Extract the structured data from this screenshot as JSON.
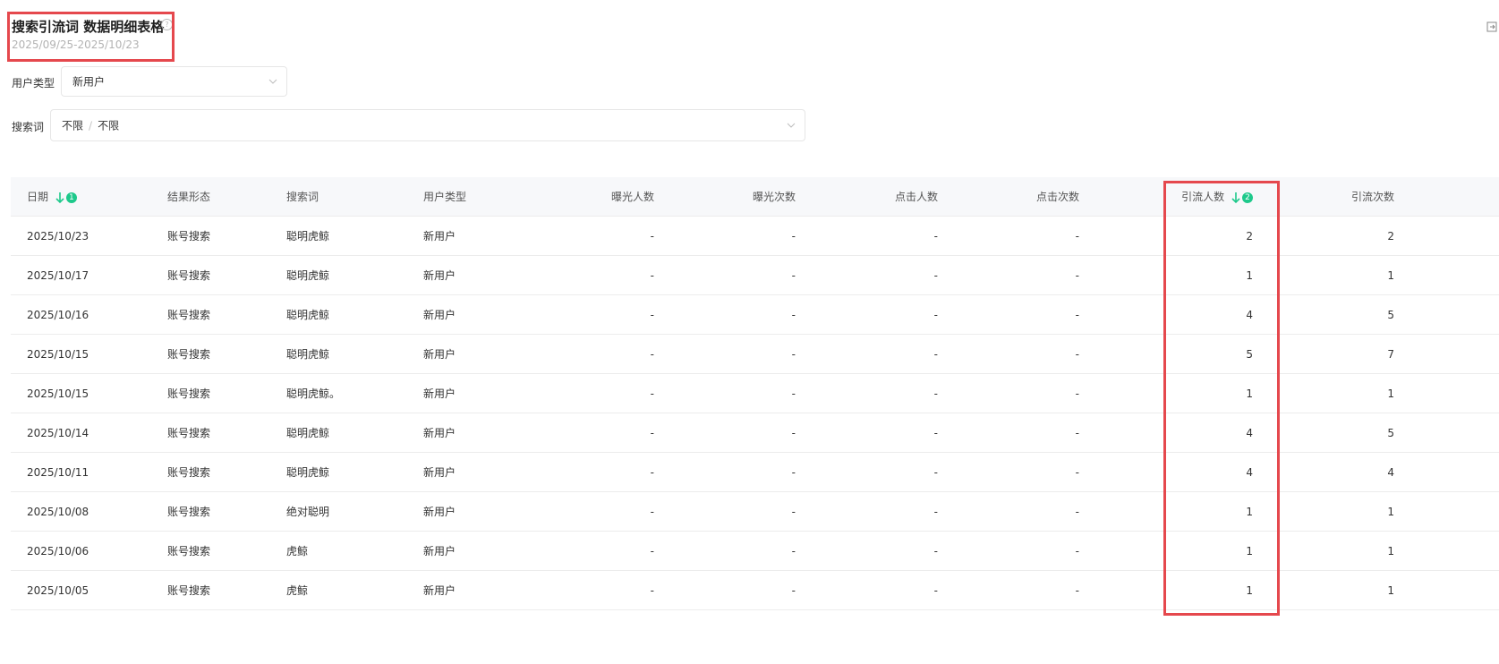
{
  "header": {
    "title": "搜索引流词 数据明细表格",
    "help_glyph": "?",
    "date_range": "2025/09/25-2025/10/23"
  },
  "filters": {
    "user_type": {
      "label": "用户类型",
      "value": "新用户"
    },
    "keyword": {
      "label": "搜索词",
      "value_primary": "不限",
      "separator": "/",
      "value_secondary": "不限"
    }
  },
  "sort": {
    "date_badge": "1",
    "flow_users_badge": "2",
    "color": "#1ec98b"
  },
  "accent": {
    "highlight": "#e5484d"
  },
  "table": {
    "columns": [
      "日期",
      "结果形态",
      "搜索词",
      "用户类型",
      "曝光人数",
      "曝光次数",
      "点击人数",
      "点击次数",
      "引流人数",
      "引流次数"
    ],
    "rows": [
      [
        "2025/10/23",
        "账号搜索",
        "聪明虎鲸",
        "新用户",
        "-",
        "-",
        "-",
        "-",
        "2",
        "2"
      ],
      [
        "2025/10/17",
        "账号搜索",
        "聪明虎鲸",
        "新用户",
        "-",
        "-",
        "-",
        "-",
        "1",
        "1"
      ],
      [
        "2025/10/16",
        "账号搜索",
        "聪明虎鲸",
        "新用户",
        "-",
        "-",
        "-",
        "-",
        "4",
        "5"
      ],
      [
        "2025/10/15",
        "账号搜索",
        "聪明虎鲸",
        "新用户",
        "-",
        "-",
        "-",
        "-",
        "5",
        "7"
      ],
      [
        "2025/10/15",
        "账号搜索",
        "聪明虎鲸。",
        "新用户",
        "-",
        "-",
        "-",
        "-",
        "1",
        "1"
      ],
      [
        "2025/10/14",
        "账号搜索",
        "聪明虎鲸",
        "新用户",
        "-",
        "-",
        "-",
        "-",
        "4",
        "5"
      ],
      [
        "2025/10/11",
        "账号搜索",
        "聪明虎鲸",
        "新用户",
        "-",
        "-",
        "-",
        "-",
        "4",
        "4"
      ],
      [
        "2025/10/08",
        "账号搜索",
        "绝对聪明",
        "新用户",
        "-",
        "-",
        "-",
        "-",
        "1",
        "1"
      ],
      [
        "2025/10/06",
        "账号搜索",
        "虎鲸",
        "新用户",
        "-",
        "-",
        "-",
        "-",
        "1",
        "1"
      ],
      [
        "2025/10/05",
        "账号搜索",
        "虎鲸",
        "新用户",
        "-",
        "-",
        "-",
        "-",
        "1",
        "1"
      ]
    ]
  }
}
